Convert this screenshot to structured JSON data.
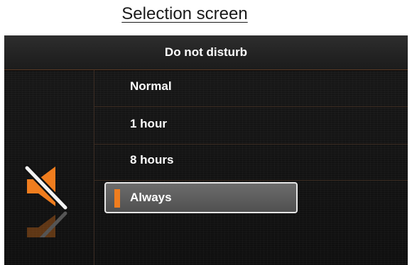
{
  "caption": "Selection screen",
  "screen": {
    "title": "Do not disturb",
    "icon": "speaker-muted-icon",
    "options": [
      {
        "label": "Normal",
        "selected": false
      },
      {
        "label": "1 hour",
        "selected": false
      },
      {
        "label": "8 hours",
        "selected": false
      },
      {
        "label": "Always",
        "selected": true
      }
    ]
  },
  "colors": {
    "accent": "#f07d1e",
    "background": "#151515",
    "text": "#ffffff",
    "selection_fill": "#5e5e5e",
    "selection_border": "#e6e6e6"
  }
}
